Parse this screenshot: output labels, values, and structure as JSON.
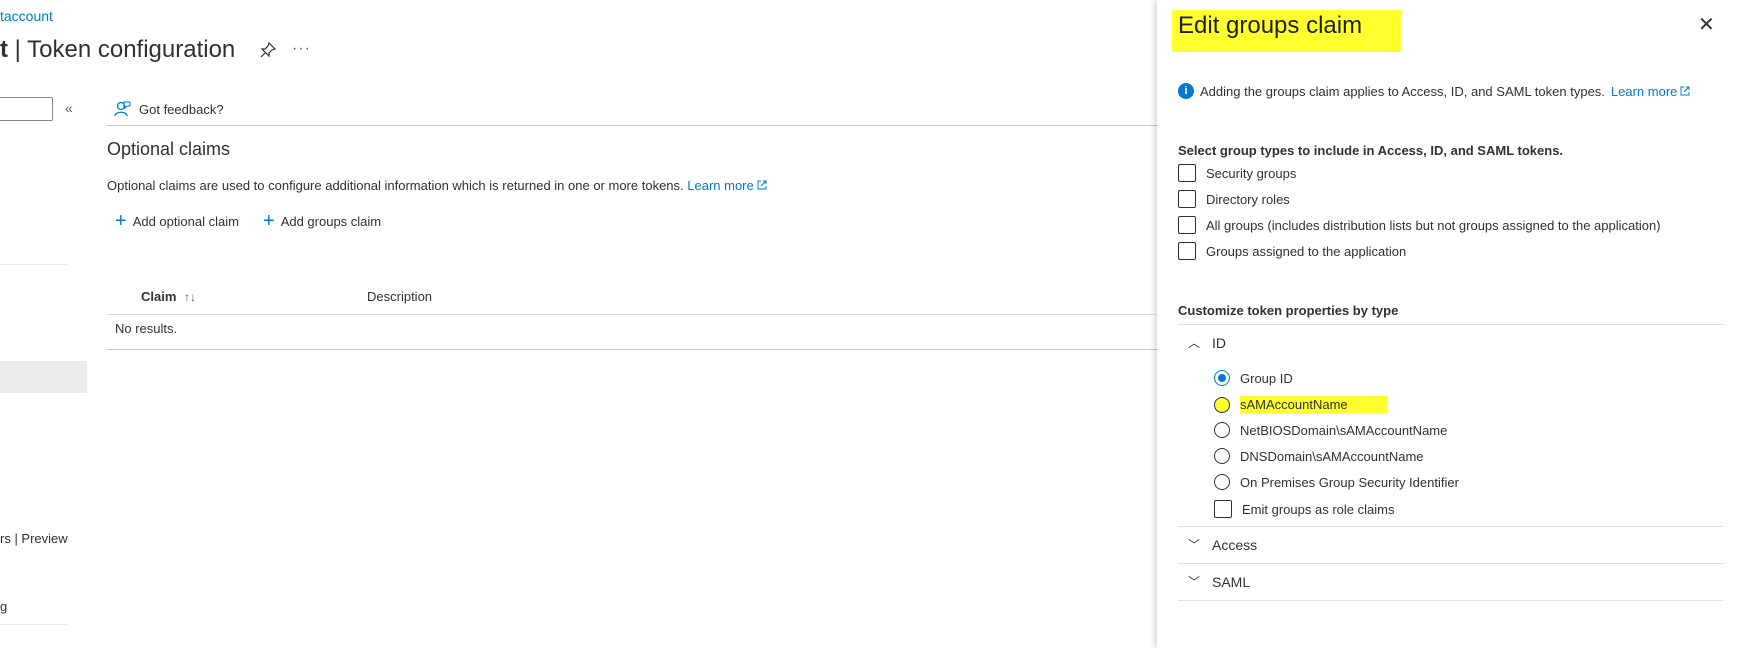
{
  "breadcrumb": "taccount",
  "page": {
    "title_prefix": "t",
    "title_rest": " | Token configuration",
    "pin_icon": "pin-icon",
    "more_label": "···"
  },
  "sidebar": {
    "collapse_label": "«",
    "item_preview": "rs | Preview",
    "item_fragment": "g"
  },
  "toolbar": {
    "feedback_label": "Got feedback?"
  },
  "optional_claims": {
    "title": "Optional claims",
    "description": "Optional claims are used to configure additional information which is returned in one or more tokens.",
    "learn_more": "Learn more",
    "add_optional_claim": "Add optional claim",
    "add_groups_claim": "Add groups claim",
    "columns": [
      "Claim",
      "Description"
    ],
    "sort_glyph": "↑↓",
    "empty_text": "No results."
  },
  "panel": {
    "title": "Edit groups claim",
    "close_label": "✕",
    "info_text": "Adding the groups claim applies to Access, ID, and SAML token types.",
    "info_learn_more": "Learn more",
    "select_label": "Select group types to include in Access, ID, and SAML tokens.",
    "group_types": [
      "Security groups",
      "Directory roles",
      "All groups (includes distribution lists but not groups assigned to the application)",
      "Groups assigned to the application"
    ],
    "customize_label": "Customize token properties by type",
    "sections": {
      "id": "ID",
      "access": "Access",
      "saml": "SAML"
    },
    "id_options": [
      "Group ID",
      "sAMAccountName",
      "NetBIOSDomain\\sAMAccountName",
      "DNSDomain\\sAMAccountName",
      "On Premises Group Security Identifier"
    ],
    "selected_option": "Group ID",
    "emit_roles": "Emit groups as role claims",
    "highlight_color": "#ffff2e",
    "accent_color": "#0078d4"
  }
}
